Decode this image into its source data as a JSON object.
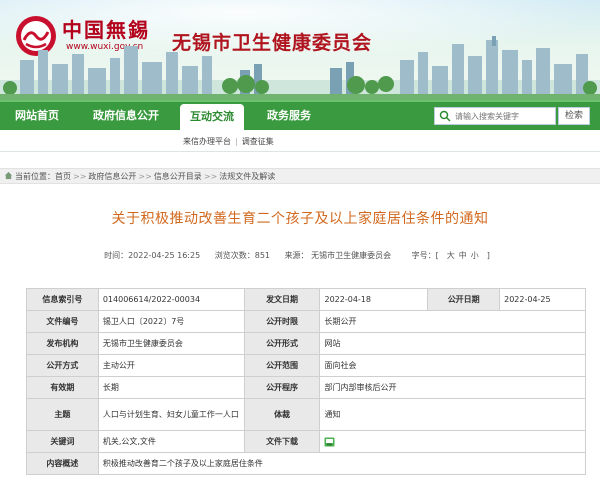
{
  "header": {
    "logo_text": "中国無錫",
    "logo_url": "www.wuxi.gov.cn",
    "site_name": "无锡市卫生健康委员会"
  },
  "nav": {
    "items": [
      {
        "label": "网站首页"
      },
      {
        "label": "政府信息公开"
      },
      {
        "label": "互动交流",
        "active": true
      },
      {
        "label": "政务服务"
      }
    ],
    "search_placeholder": "请输入搜索关键字",
    "search_button": "检索"
  },
  "subnav": {
    "items": [
      "来信办理平台",
      "调查征集"
    ]
  },
  "breadcrumb": {
    "prefix": "当前位置：",
    "items": [
      "首页",
      "政府信息公开",
      "信息公开目录",
      "法规文件及解读"
    ]
  },
  "article": {
    "title": "关于积极推动改善生育二个孩子及以上家庭居住条件的通知",
    "time": "时间：2022-04-25 16:25",
    "views": "浏览次数：851",
    "source": "来源：  无锡市卫生健康委员会",
    "font_size_label": "字号：[",
    "font_sizes": [
      "大",
      "中",
      "小"
    ],
    "font_size_end": "]"
  },
  "info_table": {
    "rows": [
      {
        "k1": "信息索引号",
        "v1": "014006614/2022-00034",
        "k2": "发文日期",
        "v2": "2022-04-18",
        "k3": "公开日期",
        "v3": "2022-04-25"
      },
      {
        "k1": "文件编号",
        "v1": "锡卫人口〔2022〕7号",
        "k2": "公开时限",
        "v2": "长期公开"
      },
      {
        "k1": "发布机构",
        "v1": "无锡市卫生健康委员会",
        "k2": "公开形式",
        "v2": "网站"
      },
      {
        "k1": "公开方式",
        "v1": "主动公开",
        "k2": "公开范围",
        "v2": "面向社会"
      },
      {
        "k1": "有效期",
        "v1": "长期",
        "k2": "公开程序",
        "v2": "部门内部审核后公开"
      },
      {
        "k1": "主题",
        "v1": "人口与计划生育、妇女儿童工作一人口",
        "k2": "体裁",
        "v2": "通知"
      },
      {
        "k1": "关键词",
        "v1": "机关,公文,文件",
        "k2": "文件下载",
        "v2": ""
      },
      {
        "k1": "内容概述",
        "v1": "积极推动改善育二个孩子及以上家庭居住条件"
      }
    ]
  },
  "colors": {
    "nav_green": "#3a9a3f",
    "title_orange": "#d2691e",
    "brand_red": "#b0141f"
  }
}
